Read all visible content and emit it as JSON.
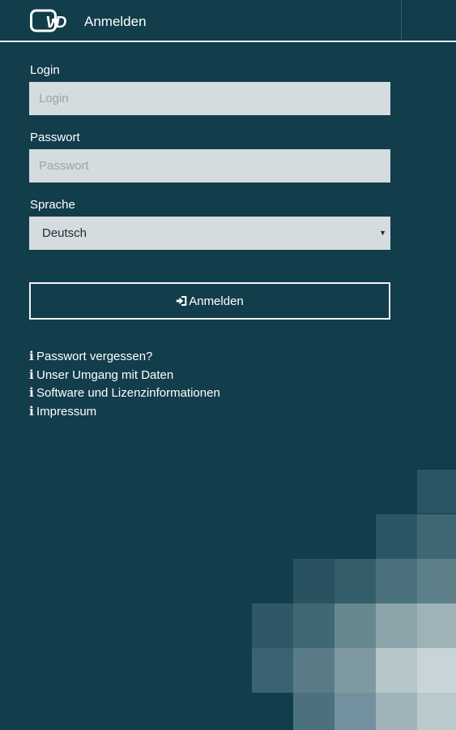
{
  "header": {
    "title": "Anmelden"
  },
  "form": {
    "login": {
      "label": "Login",
      "placeholder": "Login",
      "value": ""
    },
    "password": {
      "label": "Passwort",
      "placeholder": "Passwort",
      "value": ""
    },
    "language": {
      "label": "Sprache",
      "selected": "Deutsch"
    },
    "submit_label": "Anmelden"
  },
  "links": [
    {
      "label": "Passwort vergessen?",
      "icon": "info-icon"
    },
    {
      "label": "Unser Umgang mit Daten",
      "icon": "info-icon"
    },
    {
      "label": "Software und Lizenzinformationen",
      "icon": "info-icon"
    },
    {
      "label": "Impressum",
      "icon": "info-icon"
    }
  ],
  "colors": {
    "background": "#123d4b",
    "input_background": "#d5dcdf",
    "text": "#ffffff"
  }
}
